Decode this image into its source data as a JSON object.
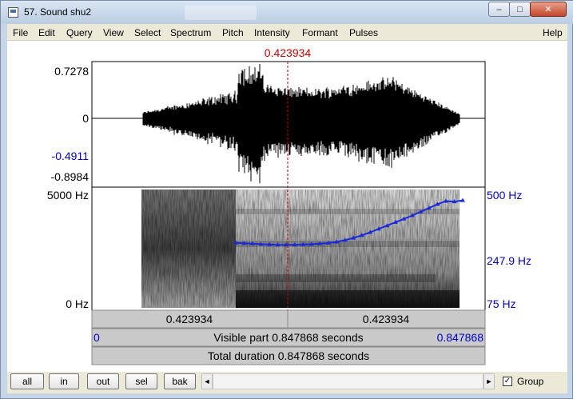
{
  "window": {
    "title": "57. Sound shu2",
    "controls": {
      "minimize": "–",
      "maximize": "□",
      "close": "✕"
    }
  },
  "menu": [
    "File",
    "Edit",
    "Query",
    "View",
    "Select",
    "Spectrum",
    "Pitch",
    "Intensity",
    "Formant",
    "Pulses"
  ],
  "help_label": "Help",
  "cursor": {
    "time_label": "0.423934",
    "time_s": 0.423934
  },
  "waveform": {
    "y_max_label": "0.7278",
    "y_zero_label": "0",
    "y_min_label": "-0.8984",
    "y_cursor_label": "-0.4911"
  },
  "spectrogram": {
    "f_max_label": "5000 Hz",
    "f_min_label": "0 Hz",
    "pitch_top_label": "500 Hz",
    "pitch_cursor_label": "247.9 Hz",
    "pitch_bottom_label": "75 Hz"
  },
  "pitch_curve": {
    "pitch_hz": [
      213,
      211,
      210,
      208,
      207,
      206,
      206,
      206,
      207,
      208,
      210,
      212,
      216,
      222,
      230,
      240,
      252,
      266,
      280,
      296,
      312,
      330,
      350,
      372,
      395,
      415,
      412,
      420
    ]
  },
  "selection_bar": {
    "left_label": "0.423934",
    "right_label": "0.423934"
  },
  "visible_bar": {
    "start": "0",
    "text": "Visible part 0.847868 seconds",
    "end": "0.847868"
  },
  "total_bar": {
    "text": "Total duration 0.847868 seconds"
  },
  "buttons": {
    "all": "all",
    "in": "in",
    "out": "out",
    "sel": "sel",
    "bak": "bak"
  },
  "scroll": {
    "left_arrow": "◄",
    "right_arrow": "►"
  },
  "group": {
    "label": "Group",
    "checked": "✓"
  },
  "colors": {
    "cursor": "#cc0000",
    "axis_blue": "#0000cc",
    "pitch": "#1a2ad8"
  }
}
